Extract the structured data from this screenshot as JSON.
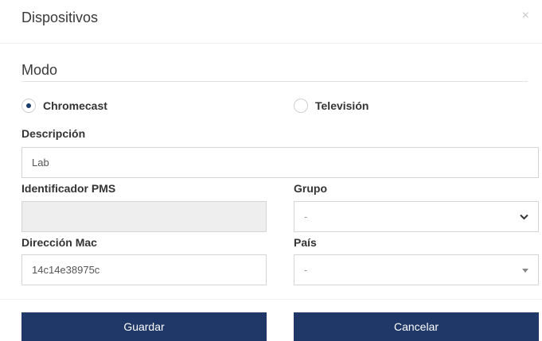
{
  "modal": {
    "title": "Dispositivos",
    "close_glyph": "×"
  },
  "section": {
    "title": "Modo"
  },
  "mode": {
    "chromecast_label": "Chromecast",
    "television_label": "Televisión",
    "selected": "Chromecast"
  },
  "fields": {
    "descripcion_label": "Descripción",
    "descripcion_value": "Lab",
    "identificador_label": "Identificador PMS",
    "identificador_value": "",
    "grupo_label": "Grupo",
    "grupo_value": "-",
    "mac_label": "Dirección Mac",
    "mac_value": "14c14e38975c",
    "pais_label": "País",
    "pais_value": "-"
  },
  "buttons": {
    "save_label": "Guardar",
    "cancel_label": "Cancelar"
  },
  "colors": {
    "primary": "#1f3868",
    "radio_dot": "#1c3c6b"
  }
}
